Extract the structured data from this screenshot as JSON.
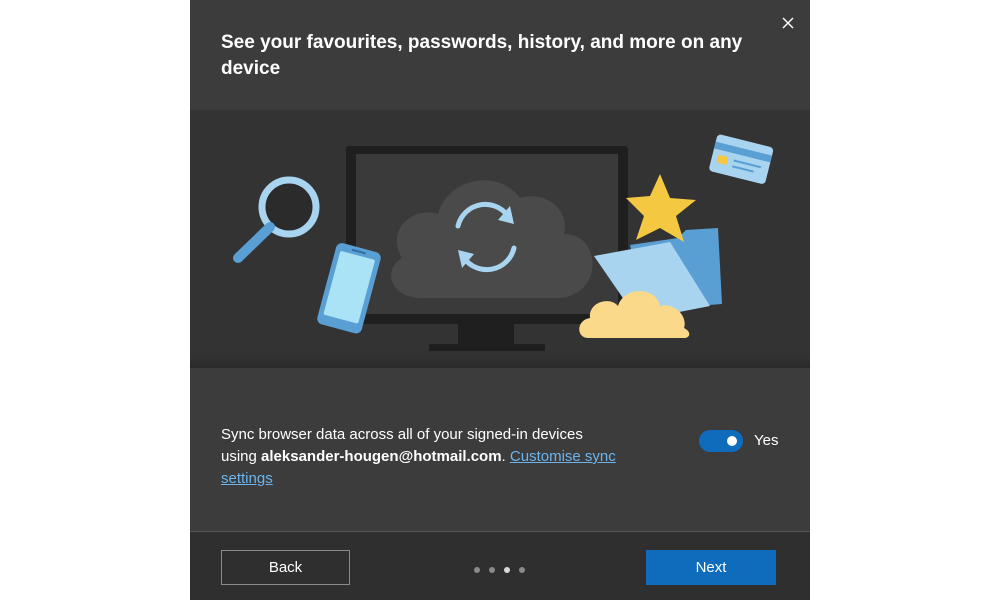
{
  "dialog": {
    "title": "See your favourites, passwords, history, and more on any device",
    "close_icon": "close-icon",
    "illustration_icons": [
      "magnifier-icon",
      "phone-icon",
      "monitor-icon",
      "sync-cloud-icon",
      "credit-card-icon",
      "star-icon",
      "folder-icon",
      "cloud-icon"
    ]
  },
  "sync": {
    "text_prefix": "Sync browser data across all of your signed-in devices using ",
    "email": "aleksander-hougen@hotmail.com",
    "text_suffix": ". ",
    "link_label": "Customise sync settings",
    "toggle_state": true,
    "toggle_label": "Yes"
  },
  "footer": {
    "back_label": "Back",
    "next_label": "Next",
    "pagination": {
      "total": 4,
      "current": 3
    }
  },
  "colors": {
    "dialog_bg": "#3c3c3c",
    "illustration_bg": "#333333",
    "footer_bg": "#2f2f2f",
    "accent": "#0f6cbd",
    "link": "#6cb4ee"
  }
}
